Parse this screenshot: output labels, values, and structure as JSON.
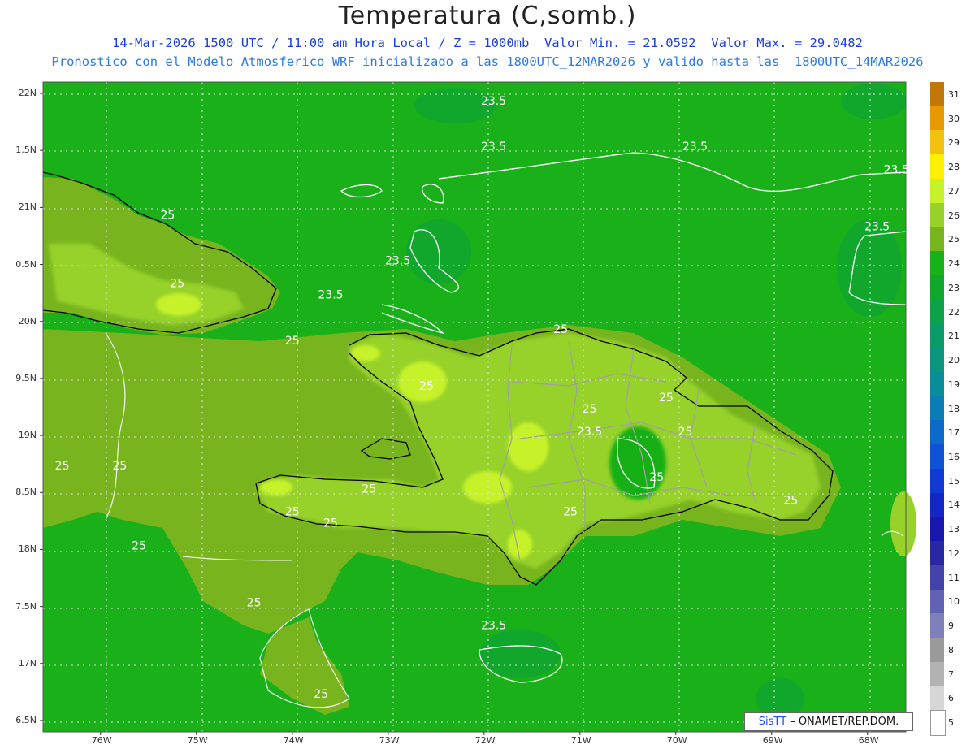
{
  "header": {
    "title": "Temperatura (C,somb.)",
    "line1": "14-Mar-2026 1500 UTC / 11:00 am Hora Local / Z = 1000mb  Valor Min. = 21.0592  Valor Max. = 29.0482",
    "line2": "Pronostico con el Modelo Atmosferico WRF inicializado a las 1800UTC_12MAR2026 y valido hasta las  1800UTC_14MAR2026"
  },
  "map": {
    "lon_range": [
      -76.6,
      -67.6
    ],
    "lat_range": [
      16.4,
      22.1
    ],
    "x_ticks": [
      "76W",
      "75W",
      "74W",
      "73W",
      "72W",
      "71W",
      "70W",
      "69W",
      "68W"
    ],
    "y_ticks": [
      "22N",
      "1.5N",
      "21N",
      "0.5N",
      "20N",
      "9.5N",
      "19N",
      "8.5N",
      "18N",
      "7.5N",
      "17N",
      "6.5N"
    ],
    "contour_labels": [
      {
        "text": "23.5",
        "lon": -71.9,
        "lat": 21.9
      },
      {
        "text": "23.5",
        "lon": -71.9,
        "lat": 21.5
      },
      {
        "text": "23.5",
        "lon": -69.8,
        "lat": 21.5
      },
      {
        "text": "23.5",
        "lon": -67.7,
        "lat": 21.3
      },
      {
        "text": "23.5",
        "lon": -67.9,
        "lat": 20.8
      },
      {
        "text": "23.5",
        "lon": -72.9,
        "lat": 20.5
      },
      {
        "text": "23.5",
        "lon": -73.6,
        "lat": 20.2
      },
      {
        "text": "23.5",
        "lon": -70.9,
        "lat": 19.0
      },
      {
        "text": "23.5",
        "lon": -71.9,
        "lat": 17.3
      },
      {
        "text": "25",
        "lon": -75.3,
        "lat": 20.9
      },
      {
        "text": "25",
        "lon": -75.2,
        "lat": 20.3
      },
      {
        "text": "25",
        "lon": -74.0,
        "lat": 19.8
      },
      {
        "text": "25",
        "lon": -72.6,
        "lat": 19.4
      },
      {
        "text": "25",
        "lon": -71.2,
        "lat": 19.9
      },
      {
        "text": "25",
        "lon": -70.9,
        "lat": 19.2
      },
      {
        "text": "25",
        "lon": -70.1,
        "lat": 19.3
      },
      {
        "text": "25",
        "lon": -69.9,
        "lat": 19.0
      },
      {
        "text": "25",
        "lon": -70.2,
        "lat": 18.6
      },
      {
        "text": "25",
        "lon": -73.2,
        "lat": 18.5
      },
      {
        "text": "25",
        "lon": -74.0,
        "lat": 18.3
      },
      {
        "text": "25",
        "lon": -73.6,
        "lat": 18.2
      },
      {
        "text": "25",
        "lon": -71.1,
        "lat": 18.3
      },
      {
        "text": "25",
        "lon": -68.8,
        "lat": 18.4
      },
      {
        "text": "25",
        "lon": -76.4,
        "lat": 18.7
      },
      {
        "text": "25",
        "lon": -75.8,
        "lat": 18.7
      },
      {
        "text": "25",
        "lon": -75.6,
        "lat": 18.0
      },
      {
        "text": "25",
        "lon": -74.4,
        "lat": 17.5
      },
      {
        "text": "25",
        "lon": -73.7,
        "lat": 16.7
      }
    ]
  },
  "colorbar": {
    "labels": [
      "31",
      "30",
      "29",
      "28",
      "27",
      "26",
      "25",
      "24",
      "23",
      "22",
      "21",
      "20",
      "19",
      "18",
      "17",
      "16",
      "15",
      "14",
      "13",
      "12",
      "11",
      "10",
      "9",
      "8",
      "7",
      "6",
      "5"
    ],
    "colors": [
      "#c07808",
      "#e69a00",
      "#f2c211",
      "#fff000",
      "#c6f22a",
      "#96d22a",
      "#78b41e",
      "#19b019",
      "#11a72c",
      "#0da24a",
      "#0b9b68",
      "#0b957f",
      "#0a8d98",
      "#0c7db4",
      "#0c6ac8",
      "#0f52d6",
      "#1238d8",
      "#1426c8",
      "#1818b0",
      "#2828a0",
      "#4444a8",
      "#6262b4",
      "#8080b8",
      "#9a9a9a",
      "#b2b2b2",
      "#d6d6d6",
      "#ffffff"
    ]
  },
  "credit": {
    "brand": "SisTT",
    "text": " – ONAMET/REP.DOM."
  }
}
